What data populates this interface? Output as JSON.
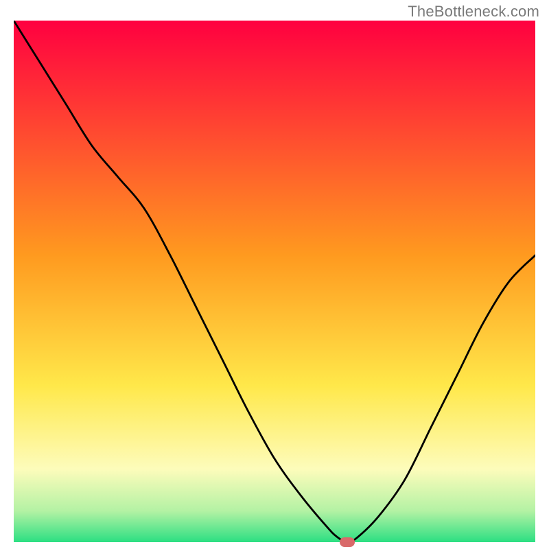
{
  "watermark": "TheBottleneck.com",
  "colors": {
    "gradient": [
      "#ff0040",
      "#ff9a1f",
      "#ffe84a",
      "#fdfcbb",
      "#b4f2a4",
      "#2bdf82"
    ],
    "curve": "#000000",
    "marker": "#d96a6a",
    "frame": "#000000"
  },
  "chart_data": {
    "type": "line",
    "title": "",
    "xlabel": "",
    "ylabel": "",
    "xlim": [
      0,
      100
    ],
    "ylim": [
      0,
      100
    ],
    "grid": false,
    "x": [
      0,
      5,
      10,
      15,
      20,
      25,
      30,
      35,
      40,
      45,
      50,
      55,
      60,
      62,
      64,
      66,
      70,
      75,
      80,
      85,
      90,
      95,
      100
    ],
    "bottleneck": [
      100,
      92,
      84,
      76,
      70,
      64,
      55,
      45,
      35,
      25,
      16,
      9,
      3,
      1,
      0,
      1,
      5,
      12,
      22,
      32,
      42,
      50,
      55
    ],
    "min_marker": {
      "x": 64,
      "y": 0
    }
  }
}
